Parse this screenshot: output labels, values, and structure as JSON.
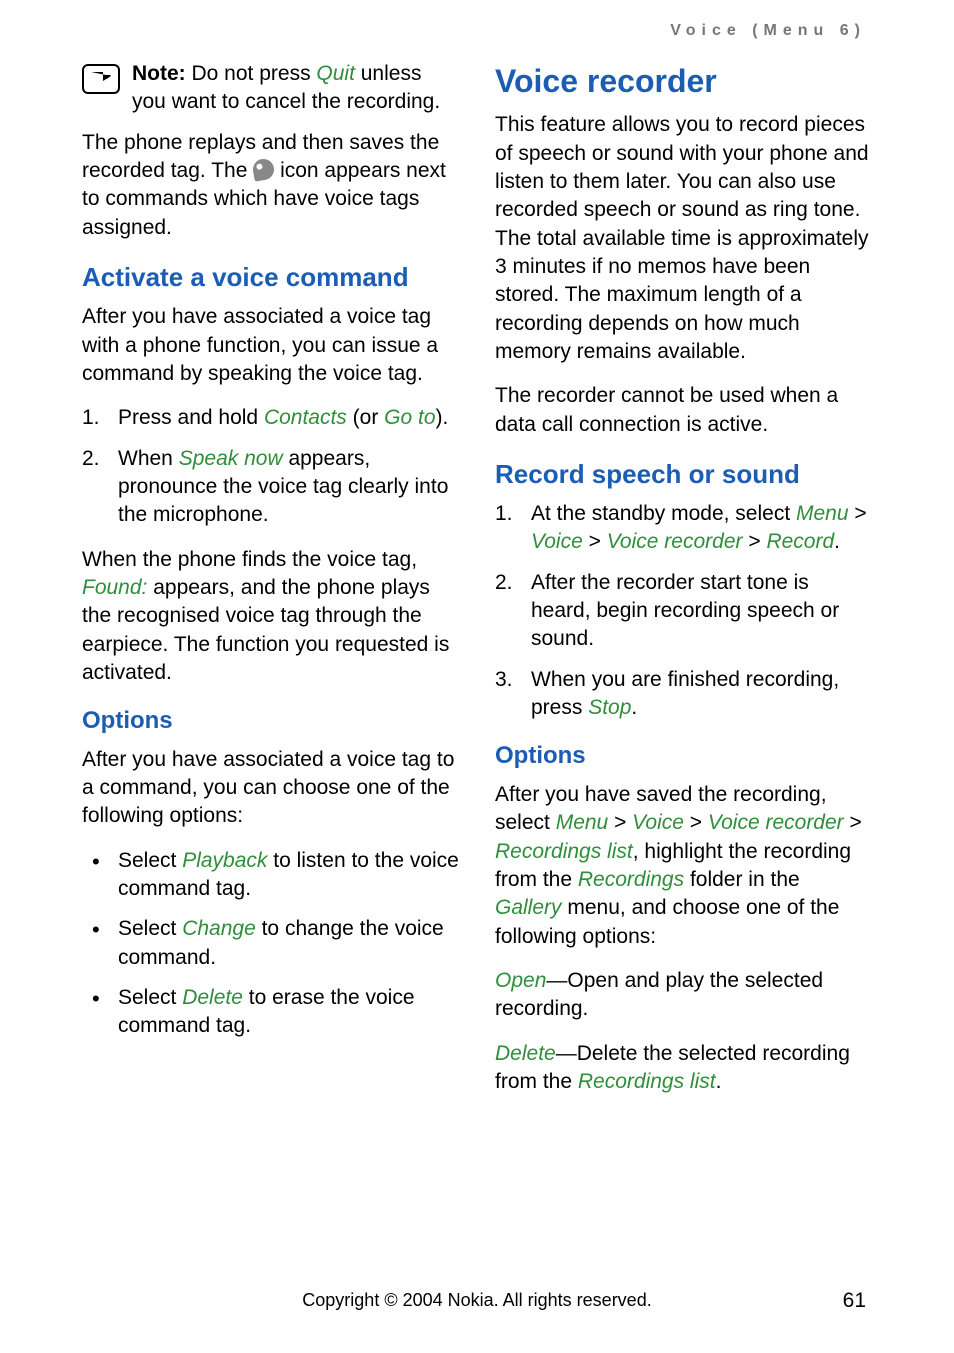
{
  "running_header": "Voice (Menu 6)",
  "left": {
    "note_label": "Note:",
    "note_p1_a": " Do not press ",
    "note_p1_quit": "Quit",
    "note_p1_b": " unless you want to cancel the recording.",
    "p2_a": "The phone replays and then saves the recorded tag. The ",
    "p2_b": " icon appears next to commands which have voice tags assigned.",
    "h2_activate": "Activate a voice command",
    "p3": "After you have associated a voice tag with a phone function, you can issue a command by speaking the voice tag.",
    "ol1": [
      {
        "num": "1.",
        "a": "Press and hold ",
        "g1": "Contacts",
        "b": " (or ",
        "g2": "Go to",
        "c": ")."
      },
      {
        "num": "2.",
        "a": "When ",
        "g1": "Speak now",
        "b": " appears, pronounce the voice tag clearly into the microphone."
      }
    ],
    "p4_a": "When the phone finds the voice tag, ",
    "p4_found": "Found:",
    "p4_b": " appears, and the phone plays the recognised voice tag through the earpiece. The function you requested is activated.",
    "h3_options": "Options",
    "p5": "After you have associated a voice tag to a command, you can choose one of the following options:",
    "ul1": [
      {
        "a": "Select ",
        "g": "Playback",
        "b": " to listen to the voice command tag."
      },
      {
        "a": "Select ",
        "g": "Change",
        "b": " to change the voice command."
      },
      {
        "a": "Select ",
        "g": "Delete",
        "b": " to erase the voice command tag."
      }
    ]
  },
  "right": {
    "h1_voice_recorder": "Voice recorder",
    "p1": "This feature allows you to record pieces of speech or sound with your phone and listen to them later. You can also use recorded speech or sound as ring tone. The total available time is approximately 3 minutes if no memos have been stored. The maximum length of a recording depends on how much memory remains available.",
    "p2": "The recorder cannot be used when a data call connection is active.",
    "h2_record": "Record speech or sound",
    "ol1": [
      {
        "num": "1.",
        "a": "At the standby mode, select ",
        "path": [
          "Menu",
          "Voice",
          "Voice recorder",
          "Record"
        ],
        "end": "."
      },
      {
        "num": "2.",
        "text": "After the recorder start tone is heard, begin recording speech or sound."
      },
      {
        "num": "3.",
        "a": "When you are finished recording, press ",
        "g": "Stop",
        "b": "."
      }
    ],
    "h3_options": "Options",
    "p3_a": "After you have saved the recording, select ",
    "p3_path": [
      "Menu",
      "Voice",
      "Voice recorder",
      "Recordings list"
    ],
    "p3_b": ", highlight the recording from the ",
    "p3_recordings": "Recordings",
    "p3_c": " folder in the ",
    "p3_gallery": "Gallery",
    "p3_d": " menu, and choose one of the following options:",
    "defs": [
      {
        "term": "Open",
        "desc": "—Open and play the selected recording."
      },
      {
        "term": "Delete",
        "desc_a": "—Delete the selected recording from the ",
        "desc_g": "Recordings list",
        "desc_b": "."
      }
    ]
  },
  "footer": "Copyright © 2004 Nokia. All rights reserved.",
  "page_number": "61"
}
